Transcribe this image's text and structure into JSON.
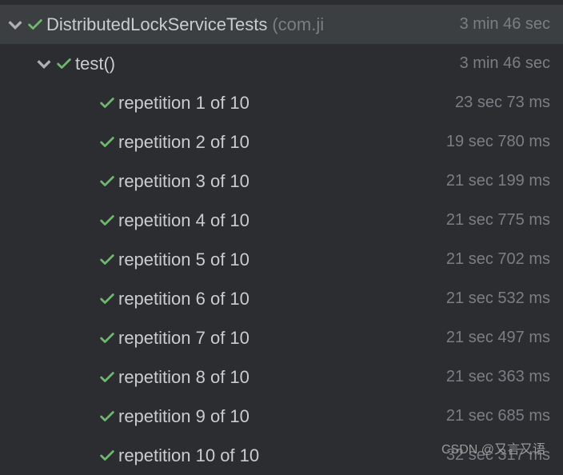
{
  "root": {
    "label": "DistributedLockServiceTests",
    "package": "(com.ji",
    "duration": "3 min 46 sec"
  },
  "test": {
    "label": "test()",
    "duration": "3 min 46 sec"
  },
  "repetitions": [
    {
      "label": "repetition 1 of 10",
      "duration": "23 sec 73 ms"
    },
    {
      "label": "repetition 2 of 10",
      "duration": "19 sec 780 ms"
    },
    {
      "label": "repetition 3 of 10",
      "duration": "21 sec 199 ms"
    },
    {
      "label": "repetition 4 of 10",
      "duration": "21 sec 775 ms"
    },
    {
      "label": "repetition 5 of 10",
      "duration": "21 sec 702 ms"
    },
    {
      "label": "repetition 6 of 10",
      "duration": "21 sec 532 ms"
    },
    {
      "label": "repetition 7 of 10",
      "duration": "21 sec 497 ms"
    },
    {
      "label": "repetition 8 of 10",
      "duration": "21 sec 363 ms"
    },
    {
      "label": "repetition 9 of 10",
      "duration": "21 sec 685 ms"
    },
    {
      "label": "repetition 10 of 10",
      "duration": "32 sec 317 ms"
    }
  ],
  "watermark": "CSDN @又言又语"
}
